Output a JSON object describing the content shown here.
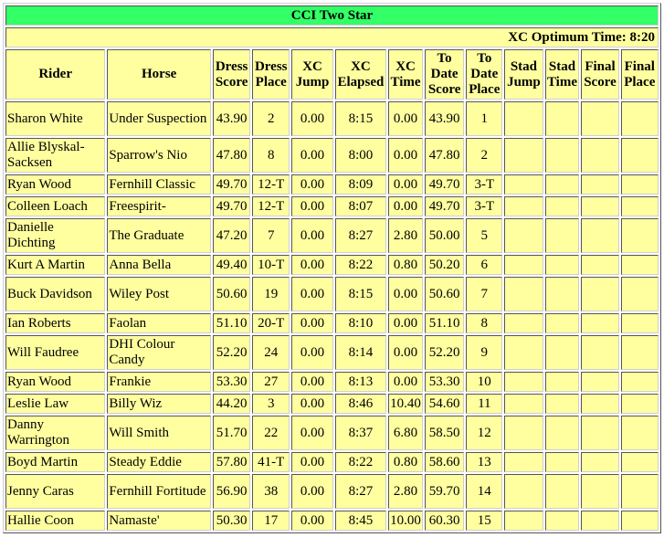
{
  "title": "CCI Two Star",
  "optimum_time": "XC Optimum Time: 8:20",
  "columns": [
    {
      "key": "rider",
      "line1": "Rider",
      "line2": "",
      "line3": ""
    },
    {
      "key": "horse",
      "line1": "Horse",
      "line2": "",
      "line3": ""
    },
    {
      "key": "dress_score",
      "line1": "Dress",
      "line2": "Score",
      "line3": ""
    },
    {
      "key": "dress_place",
      "line1": "Dress",
      "line2": "Place",
      "line3": ""
    },
    {
      "key": "xc_jump",
      "line1": "XC",
      "line2": "Jump",
      "line3": ""
    },
    {
      "key": "xc_elapsed",
      "line1": "XC",
      "line2": "Elapsed",
      "line3": ""
    },
    {
      "key": "xc_time",
      "line1": "XC",
      "line2": "Time",
      "line3": ""
    },
    {
      "key": "to_date_score",
      "line1": "To",
      "line2": "Date",
      "line3": "Score"
    },
    {
      "key": "to_date_place",
      "line1": "To",
      "line2": "Date",
      "line3": "Place"
    },
    {
      "key": "stad_jump",
      "line1": "Stad",
      "line2": "Jump",
      "line3": ""
    },
    {
      "key": "stad_time",
      "line1": "Stad",
      "line2": "Time",
      "line3": ""
    },
    {
      "key": "final_score",
      "line1": "Final",
      "line2": "Score",
      "line3": ""
    },
    {
      "key": "final_place",
      "line1": "Final",
      "line2": "Place",
      "line3": ""
    }
  ],
  "rows": [
    {
      "rider": "Sharon White",
      "horse": "Under Suspection",
      "dress_score": "43.90",
      "dress_place": "2",
      "xc_jump": "0.00",
      "xc_elapsed": "8:15",
      "xc_time": "0.00",
      "to_date_score": "43.90",
      "to_date_place": "1",
      "stad_jump": "",
      "stad_time": "",
      "final_score": "",
      "final_place": ""
    },
    {
      "rider": "Allie Blyskal-Sacksen",
      "horse": "Sparrow's Nio",
      "dress_score": "47.80",
      "dress_place": "8",
      "xc_jump": "0.00",
      "xc_elapsed": "8:00",
      "xc_time": "0.00",
      "to_date_score": "47.80",
      "to_date_place": "2",
      "stad_jump": "",
      "stad_time": "",
      "final_score": "",
      "final_place": ""
    },
    {
      "rider": "Ryan Wood",
      "horse": "Fernhill Classic",
      "dress_score": "49.70",
      "dress_place": "12-T",
      "xc_jump": "0.00",
      "xc_elapsed": "8:09",
      "xc_time": "0.00",
      "to_date_score": "49.70",
      "to_date_place": "3-T",
      "stad_jump": "",
      "stad_time": "",
      "final_score": "",
      "final_place": ""
    },
    {
      "rider": "Colleen Loach",
      "horse": "Freespirit-",
      "dress_score": "49.70",
      "dress_place": "12-T",
      "xc_jump": "0.00",
      "xc_elapsed": "8:07",
      "xc_time": "0.00",
      "to_date_score": "49.70",
      "to_date_place": "3-T",
      "stad_jump": "",
      "stad_time": "",
      "final_score": "",
      "final_place": ""
    },
    {
      "rider": "Danielle Dichting",
      "horse": "The Graduate",
      "dress_score": "47.20",
      "dress_place": "7",
      "xc_jump": "0.00",
      "xc_elapsed": "8:27",
      "xc_time": "2.80",
      "to_date_score": "50.00",
      "to_date_place": "5",
      "stad_jump": "",
      "stad_time": "",
      "final_score": "",
      "final_place": ""
    },
    {
      "rider": "Kurt A Martin",
      "horse": "Anna Bella",
      "dress_score": "49.40",
      "dress_place": "10-T",
      "xc_jump": "0.00",
      "xc_elapsed": "8:22",
      "xc_time": "0.80",
      "to_date_score": "50.20",
      "to_date_place": "6",
      "stad_jump": "",
      "stad_time": "",
      "final_score": "",
      "final_place": ""
    },
    {
      "rider": "Buck Davidson",
      "horse": "Wiley Post",
      "dress_score": "50.60",
      "dress_place": "19",
      "xc_jump": "0.00",
      "xc_elapsed": "8:15",
      "xc_time": "0.00",
      "to_date_score": "50.60",
      "to_date_place": "7",
      "stad_jump": "",
      "stad_time": "",
      "final_score": "",
      "final_place": ""
    },
    {
      "rider": "Ian Roberts",
      "horse": "Faolan",
      "dress_score": "51.10",
      "dress_place": "20-T",
      "xc_jump": "0.00",
      "xc_elapsed": "8:10",
      "xc_time": "0.00",
      "to_date_score": "51.10",
      "to_date_place": "8",
      "stad_jump": "",
      "stad_time": "",
      "final_score": "",
      "final_place": ""
    },
    {
      "rider": "Will Faudree",
      "horse": "DHI Colour Candy",
      "dress_score": "52.20",
      "dress_place": "24",
      "xc_jump": "0.00",
      "xc_elapsed": "8:14",
      "xc_time": "0.00",
      "to_date_score": "52.20",
      "to_date_place": "9",
      "stad_jump": "",
      "stad_time": "",
      "final_score": "",
      "final_place": ""
    },
    {
      "rider": "Ryan Wood",
      "horse": "Frankie",
      "dress_score": "53.30",
      "dress_place": "27",
      "xc_jump": "0.00",
      "xc_elapsed": "8:13",
      "xc_time": "0.00",
      "to_date_score": "53.30",
      "to_date_place": "10",
      "stad_jump": "",
      "stad_time": "",
      "final_score": "",
      "final_place": ""
    },
    {
      "rider": "Leslie Law",
      "horse": "Billy Wiz",
      "dress_score": "44.20",
      "dress_place": "3",
      "xc_jump": "0.00",
      "xc_elapsed": "8:46",
      "xc_time": "10.40",
      "to_date_score": "54.60",
      "to_date_place": "11",
      "stad_jump": "",
      "stad_time": "",
      "final_score": "",
      "final_place": ""
    },
    {
      "rider": "Danny Warrington",
      "horse": "Will Smith",
      "dress_score": "51.70",
      "dress_place": "22",
      "xc_jump": "0.00",
      "xc_elapsed": "8:37",
      "xc_time": "6.80",
      "to_date_score": "58.50",
      "to_date_place": "12",
      "stad_jump": "",
      "stad_time": "",
      "final_score": "",
      "final_place": ""
    },
    {
      "rider": "Boyd Martin",
      "horse": "Steady Eddie",
      "dress_score": "57.80",
      "dress_place": "41-T",
      "xc_jump": "0.00",
      "xc_elapsed": "8:22",
      "xc_time": "0.80",
      "to_date_score": "58.60",
      "to_date_place": "13",
      "stad_jump": "",
      "stad_time": "",
      "final_score": "",
      "final_place": ""
    },
    {
      "rider": "Jenny Caras",
      "horse": "Fernhill Fortitude",
      "dress_score": "56.90",
      "dress_place": "38",
      "xc_jump": "0.00",
      "xc_elapsed": "8:27",
      "xc_time": "2.80",
      "to_date_score": "59.70",
      "to_date_place": "14",
      "stad_jump": "",
      "stad_time": "",
      "final_score": "",
      "final_place": ""
    },
    {
      "rider": "Hallie Coon",
      "horse": "Namaste'",
      "dress_score": "50.30",
      "dress_place": "17",
      "xc_jump": "0.00",
      "xc_elapsed": "8:45",
      "xc_time": "10.00",
      "to_date_score": "60.30",
      "to_date_place": "15",
      "stad_jump": "",
      "stad_time": "",
      "final_score": "",
      "final_place": ""
    }
  ]
}
